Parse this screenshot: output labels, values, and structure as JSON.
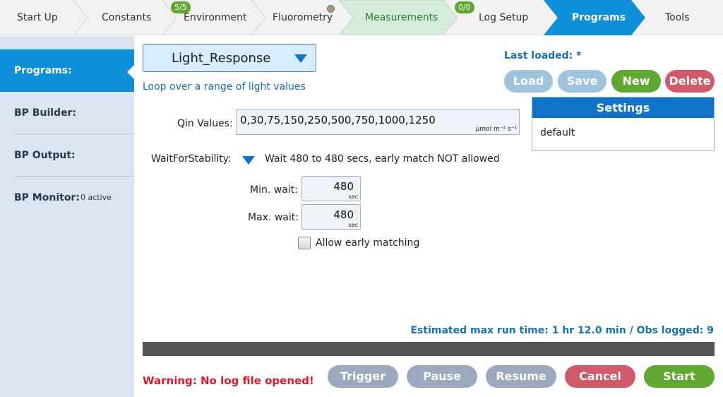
{
  "tabs": [
    {
      "label": "Start Up"
    },
    {
      "label": "Constants"
    },
    {
      "label": "Environment",
      "badge": "5/5"
    },
    {
      "label": "Fluorometry"
    },
    {
      "label": "Measurements"
    },
    {
      "label": "Log Setup",
      "badge": "0/0"
    },
    {
      "label": "Programs"
    },
    {
      "label": "Tools"
    }
  ],
  "sidebar": {
    "items": [
      {
        "label": "Programs:"
      },
      {
        "label": "BP Builder:"
      },
      {
        "label": "BP Output:"
      },
      {
        "label": "BP Monitor:",
        "sub": "0 active"
      }
    ]
  },
  "program": {
    "selected": "Light_Response",
    "description": "Loop over a range of light values"
  },
  "last_loaded": "Last loaded: *",
  "actions": {
    "load": "Load",
    "save": "Save",
    "new": "New",
    "delete": "Delete"
  },
  "settings": {
    "header": "Settings",
    "value": "default"
  },
  "qin": {
    "label": "Qin Values:",
    "value": "0,30,75,150,250,500,750,1000,1250",
    "unit": "µmol m⁻² s⁻¹"
  },
  "wait_for_stability": {
    "label": "WaitForStability:",
    "summary": "Wait 480 to 480 secs, early match NOT allowed"
  },
  "min_wait": {
    "label": "Min. wait:",
    "value": "480",
    "unit": "sec"
  },
  "max_wait": {
    "label": "Max. wait:",
    "value": "480",
    "unit": "sec"
  },
  "allow_early": {
    "label": "Allow early matching",
    "checked": false
  },
  "estimate": "Estimated max run time: 1 hr 12.0 min / Obs logged: 9",
  "progress_fraction": 0,
  "warning": "Warning: No log file opened!",
  "controls": {
    "trigger": "Trigger",
    "pause": "Pause",
    "resume": "Resume",
    "cancel": "Cancel",
    "start": "Start"
  },
  "colors": {
    "accent": "#0e8fd9",
    "disabled_button": "#9aa9bd",
    "new_button": "#5fa832",
    "delete_button": "#d05a6a",
    "warning": "#e0182a"
  }
}
